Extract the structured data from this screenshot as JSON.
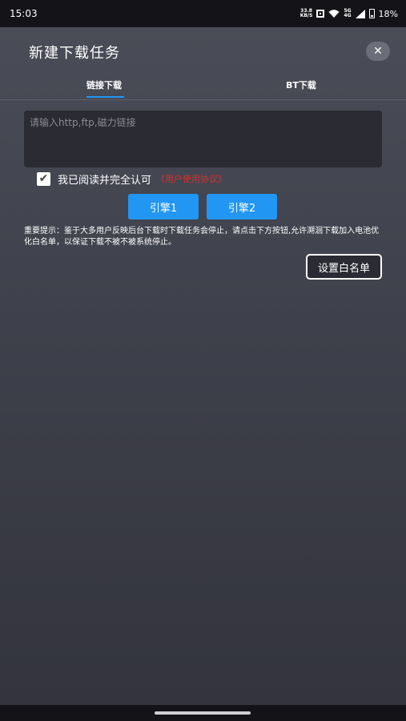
{
  "status_bar": {
    "time": "15:03",
    "net_speed_value": "33.8",
    "net_speed_unit": "KB/S",
    "network_top": "5G",
    "network_bottom": "4G",
    "battery": "18%"
  },
  "dialog": {
    "title": "新建下载任务",
    "close_icon": "✕"
  },
  "tabs": [
    {
      "label": "链接下载",
      "active": true
    },
    {
      "label": "BT下载",
      "active": false
    }
  ],
  "url_input": {
    "value": "",
    "placeholder": "请输入http,ftp,磁力链接"
  },
  "agreement": {
    "checked": true,
    "check_glyph": "✔",
    "label": "我已阅读并完全认可",
    "link": "《用户使用协议》"
  },
  "engines": {
    "engine1_label": "引擎1",
    "engine2_label": "引擎2"
  },
  "notice": "重要提示：鉴于大多用户反映后台下载时下载任务会停止，请点击下方按钮,允许溯洄下载加入电池优化白名单，以保证下载不被不被系统停止。",
  "whitelist_button": "设置白名单",
  "colors": {
    "accent": "#2196f3",
    "link_red": "#d6322c",
    "background": "#3f414c"
  }
}
